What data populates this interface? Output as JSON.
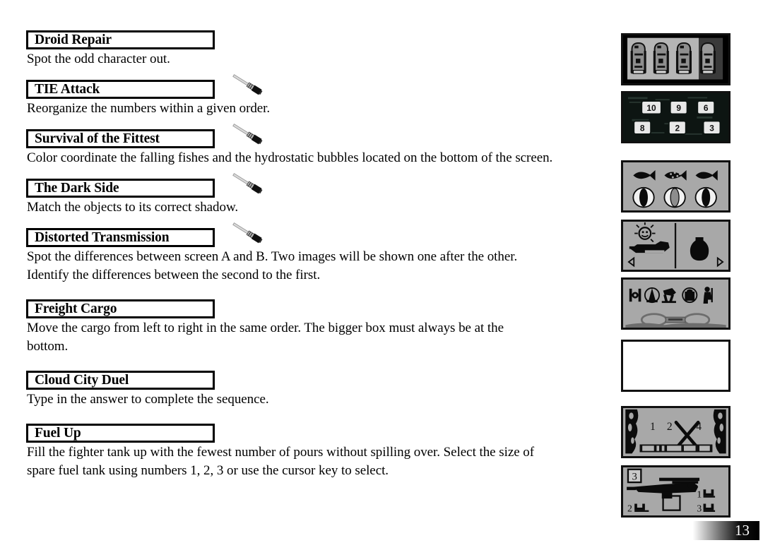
{
  "page": {
    "number": "13"
  },
  "games": [
    {
      "title": "Droid Repair",
      "description": "Spot the odd character out.",
      "has_saber_icon": false,
      "thumbnail": "droid-repair-thumbnail",
      "thumbnail_blank": false
    },
    {
      "title": "TIE Attack",
      "description": "Reorganize the numbers within a given order.",
      "has_saber_icon": true,
      "thumbnail": "tie-attack-thumbnail",
      "thumbnail_blank": false,
      "thumbnail_numbers": [
        "10",
        "9",
        "6",
        "8",
        "2",
        "3"
      ]
    },
    {
      "title": "Survival of the Fittest",
      "description": "Color coordinate the falling fishes and the hydrostatic bubbles located on the bottom of the screen.",
      "has_saber_icon": true,
      "thumbnail": "survival-of-the-fittest-thumbnail",
      "thumbnail_blank": false
    },
    {
      "title": "The Dark Side",
      "description": "Match the objects to its correct shadow.",
      "has_saber_icon": true,
      "thumbnail": "the-dark-side-thumbnail",
      "thumbnail_blank": false
    },
    {
      "title": "Distorted Transmission",
      "description": "Spot the differences between screen A and B. Two images will be shown one after the other.\nIdentify the differences between the second to the first.",
      "has_saber_icon": true,
      "thumbnail": "distorted-transmission-thumbnail",
      "thumbnail_blank": false
    },
    {
      "title": "Freight Cargo",
      "description": "Move the cargo from left to right in the same order.  The bigger box must always be at the\nbottom.",
      "has_saber_icon": false,
      "thumbnail": "freight-cargo-thumbnail",
      "thumbnail_blank": true
    },
    {
      "title": "Cloud City Duel",
      "description": "Type in the answer to complete the sequence.",
      "has_saber_icon": false,
      "thumbnail": "cloud-city-duel-thumbnail",
      "thumbnail_blank": false,
      "thumbnail_numbers": [
        "1",
        "2",
        "4"
      ]
    },
    {
      "title": "Fuel Up",
      "description": "Fill the fighter tank up with the fewest number of pours without spilling over. Select the size of\nspare fuel tank using numbers 1, 2, 3 or use the cursor key to select.",
      "has_saber_icon": false,
      "thumbnail": "fuel-up-thumbnail",
      "thumbnail_blank": false,
      "thumbnail_numbers": [
        "3",
        "1",
        "2",
        "3"
      ]
    }
  ],
  "colors": {
    "page_background": "#ffffff",
    "text": "#000000",
    "thumbnail_screen": "#a8a8a8",
    "thumbnail_border": "#111111",
    "thumbnail_dark": "#0d1512"
  }
}
